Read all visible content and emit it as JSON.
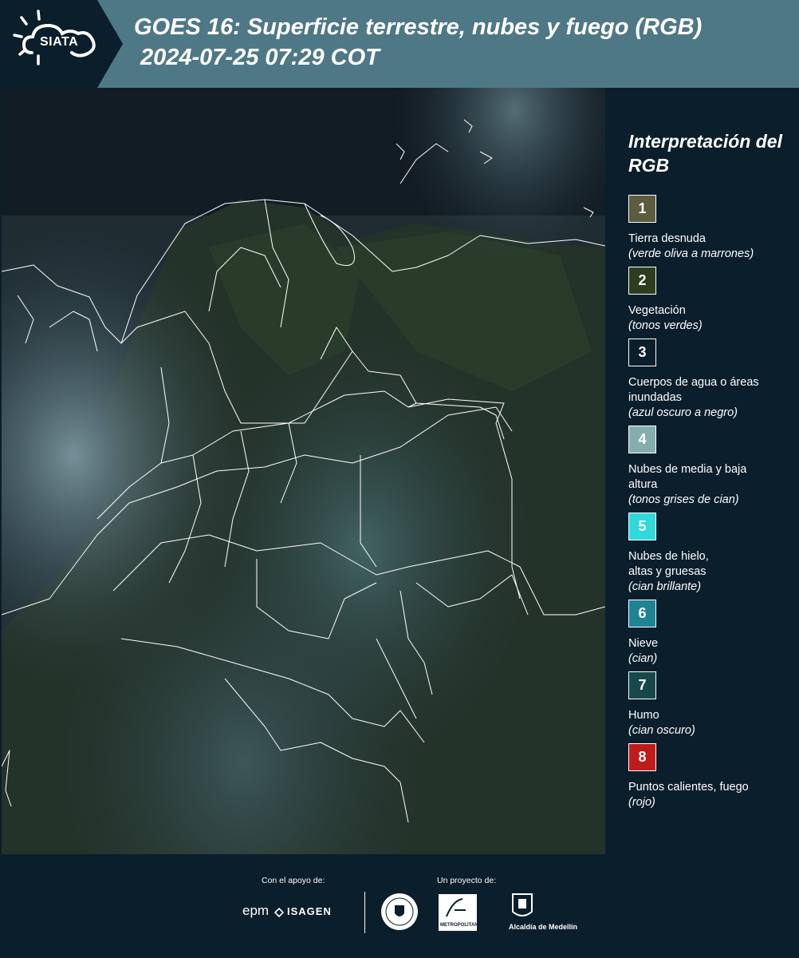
{
  "header": {
    "logo_text": "SIATA",
    "title": "GOES 16: Superficie terrestre, nubes y fuego (RGB)",
    "subtitle": "2024-07-25 07:29 COT"
  },
  "legend": {
    "title": "Interpretación del RGB",
    "items": [
      {
        "number": "1",
        "label": "Tierra desnuda",
        "note": "(verde oliva a marrones)",
        "color": "#5c5c3e"
      },
      {
        "number": "2",
        "label": "Vegetación",
        "note": "(tonos verdes)",
        "color": "#2d3e1f"
      },
      {
        "number": "3",
        "label": "Cuerpos de agua o áreas inundadas",
        "note": "(azul oscuro a negro)",
        "color": "#0b1e2b"
      },
      {
        "number": "4",
        "label": "Nubes de media y baja altura",
        "note": "(tonos grises de cian)",
        "color": "#84aeae"
      },
      {
        "number": "5",
        "label": "Nubes de hielo, altas y gruesas",
        "note": "(cian brillante)",
        "color": "#2fd9dc"
      },
      {
        "number": "6",
        "label": "Nieve",
        "note": "(cian)",
        "color": "#1f8396"
      },
      {
        "number": "7",
        "label": "Humo",
        "note": "(cian oscuro)",
        "color": "#17484c"
      },
      {
        "number": "8",
        "label": "Puntos calientes, fuego",
        "note": "(rojo)",
        "color": "#c01b1b"
      }
    ]
  },
  "footer": {
    "support_label": "Con el apoyo de:",
    "project_label": "Un proyecto de:",
    "epm": "epm",
    "isagen": "ISAGEN",
    "metro_text": "METROPOLITANA",
    "alcaldia": "Alcaldía de Medellín"
  },
  "colors": {
    "header_bg": "#4f7886",
    "page_bg": "#0b1e2b"
  }
}
